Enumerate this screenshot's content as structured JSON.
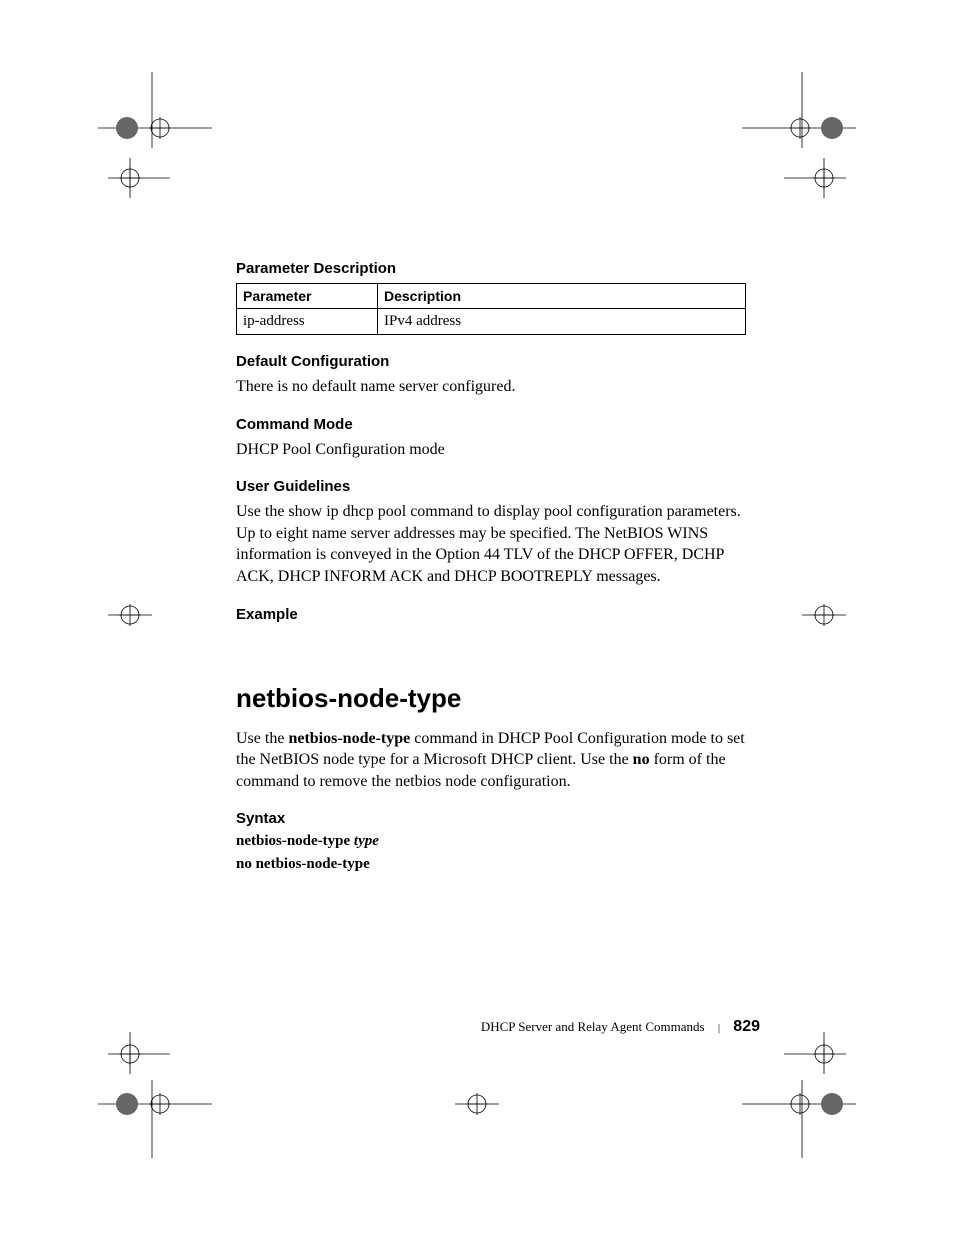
{
  "sections": {
    "param_desc_heading": "Parameter Description",
    "default_cfg_heading": "Default Configuration",
    "default_cfg_body": "There is no default name server configured.",
    "cmd_mode_heading": "Command Mode",
    "cmd_mode_body": "DHCP Pool Configuration mode",
    "user_guidelines_heading": "User Guidelines",
    "user_guidelines_body": "Use the show ip dhcp pool command to display pool configuration parameters. Up to eight name server addresses may be specified. The NetBIOS WINS information is conveyed in the Option 44 TLV of the DHCP OFFER, DCHP ACK, DHCP INFORM ACK and DHCP BOOTREPLY messages.",
    "example_heading": "Example",
    "command_heading": "netbios-node-type",
    "command_body_pre": "Use the ",
    "command_body_cmd": "netbios-node-type",
    "command_body_mid": " command in DHCP Pool Configuration mode to set the NetBIOS node type for a Microsoft DHCP client. Use the ",
    "command_body_no": "no",
    "command_body_post": " form of the command to remove the netbios node configuration.",
    "syntax_heading": "Syntax",
    "syntax_line1_cmd": "netbios-node-type",
    "syntax_line1_arg": "type",
    "syntax_line2": "no netbios-node-type"
  },
  "table": {
    "header_param": "Parameter",
    "header_desc": "Description",
    "rows": [
      {
        "param": "ip-address",
        "desc": "IPv4 address"
      }
    ]
  },
  "footer": {
    "section_title": "DHCP Server and Relay Agent Commands",
    "page_number": "829"
  }
}
